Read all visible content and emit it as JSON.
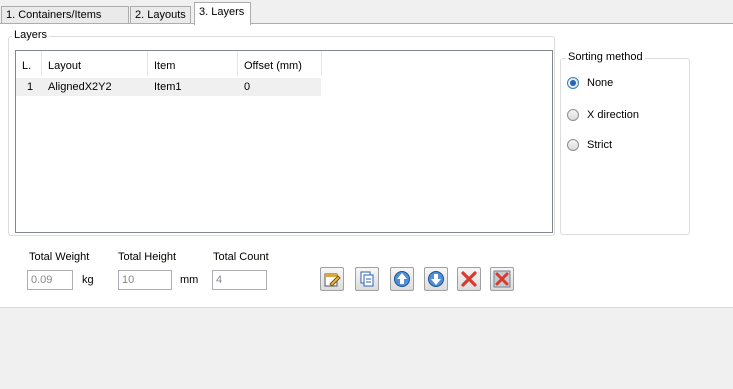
{
  "tabs": [
    {
      "label": "1. Containers/Items",
      "active": false
    },
    {
      "label": "2. Layouts",
      "active": false
    },
    {
      "label": "3. Layers",
      "active": true
    }
  ],
  "layers_group": {
    "title": "Layers",
    "columns": [
      "L.",
      "Layout",
      "Item",
      "Offset (mm)"
    ],
    "rows": [
      {
        "layer": "1",
        "layout": "AlignedX2Y2",
        "item": "Item1",
        "offset": "0"
      }
    ]
  },
  "sorting": {
    "title": "Sorting method",
    "options": [
      {
        "label": "None",
        "checked": true
      },
      {
        "label": "X direction",
        "checked": false
      },
      {
        "label": "Strict",
        "checked": false
      }
    ]
  },
  "totals": {
    "weight_label": "Total Weight",
    "weight_value": "0.09",
    "weight_unit": "kg",
    "height_label": "Total Height",
    "height_value": "10",
    "height_unit": "mm",
    "count_label": "Total Count",
    "count_value": "4"
  },
  "toolbar_icons": [
    "edit-layer-icon",
    "copy-layer-icon",
    "move-up-icon",
    "move-down-icon",
    "delete-icon",
    "delete-all-icon"
  ],
  "colors": {
    "accent_blue": "#2a63b8",
    "delete_red": "#d83a2e"
  }
}
